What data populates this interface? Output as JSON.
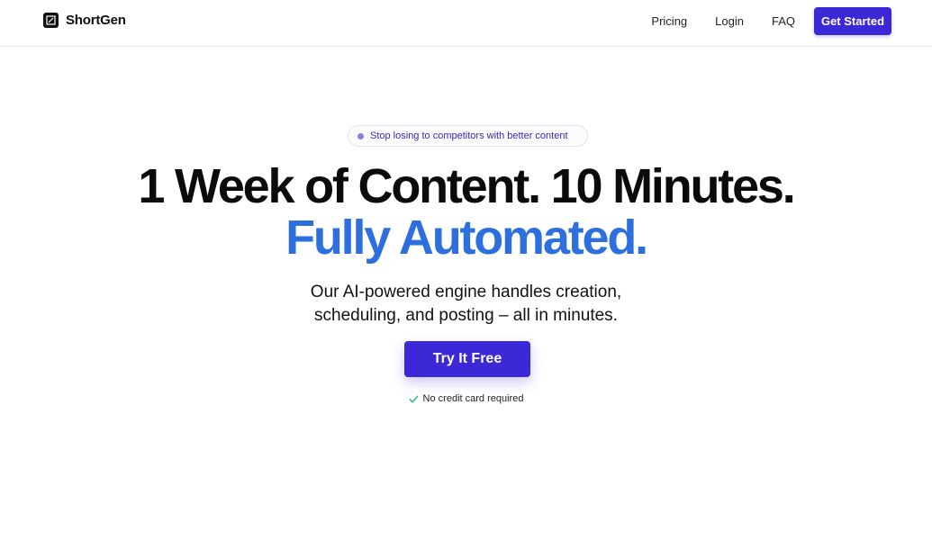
{
  "nav": {
    "brand_name": "ShortGen",
    "links": [
      "Pricing",
      "Login",
      "FAQ"
    ],
    "cta_label": "Get Started"
  },
  "hero": {
    "pill_text": "Stop losing to competitors with better content",
    "headline": "1 Week of Content. 10 Minutes.",
    "headline_accent": "Fully Automated.",
    "subline_1": "Our AI-powered engine handles creation,",
    "subline_2": "scheduling, and posting – all in minutes.",
    "cta_label": "Try It Free",
    "note_text": "No credit card required"
  },
  "colors": {
    "accent": "#3b28d6",
    "headline_accent": "#2e6fe0",
    "check": "#22b573"
  },
  "icons": {
    "logo": "square-logo-icon",
    "pill": "dot-icon",
    "note": "check-icon"
  }
}
